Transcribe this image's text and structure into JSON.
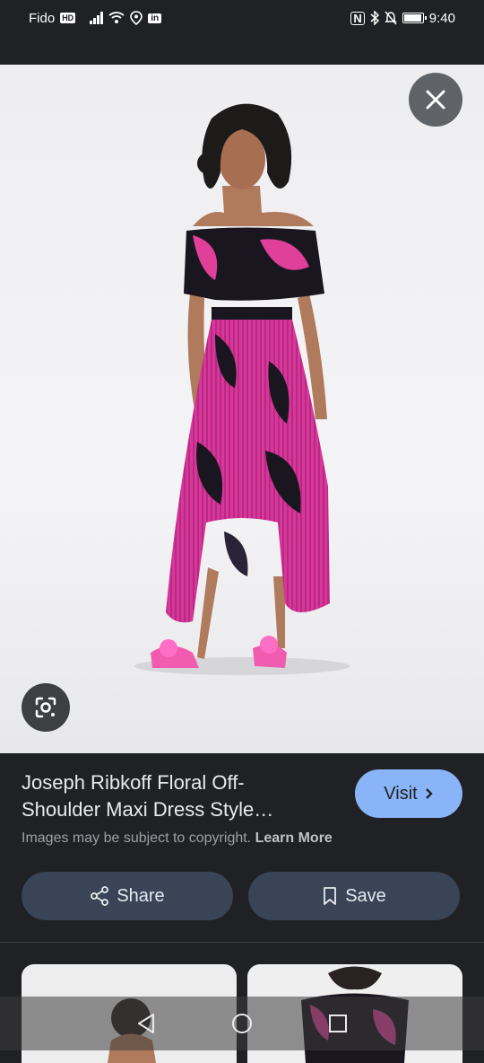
{
  "status_bar": {
    "carrier": "Fido",
    "hd_label": "HD",
    "time": "9:40"
  },
  "viewer": {
    "close_icon": "close-icon",
    "lens_icon": "google-lens-icon"
  },
  "info": {
    "title_line1": "Joseph Ribkoff Floral Off-",
    "title_line2": "Shoulder Maxi Dress Style…",
    "visit_label": "Visit",
    "copyright_text": "Images may be subject to copyright.",
    "learn_more": "Learn More",
    "share_label": "Share",
    "save_label": "Save"
  },
  "colors": {
    "background": "#202124",
    "accent": "#8ab4f8",
    "button_bg": "#394457",
    "dress_pink": "#e0409a"
  }
}
